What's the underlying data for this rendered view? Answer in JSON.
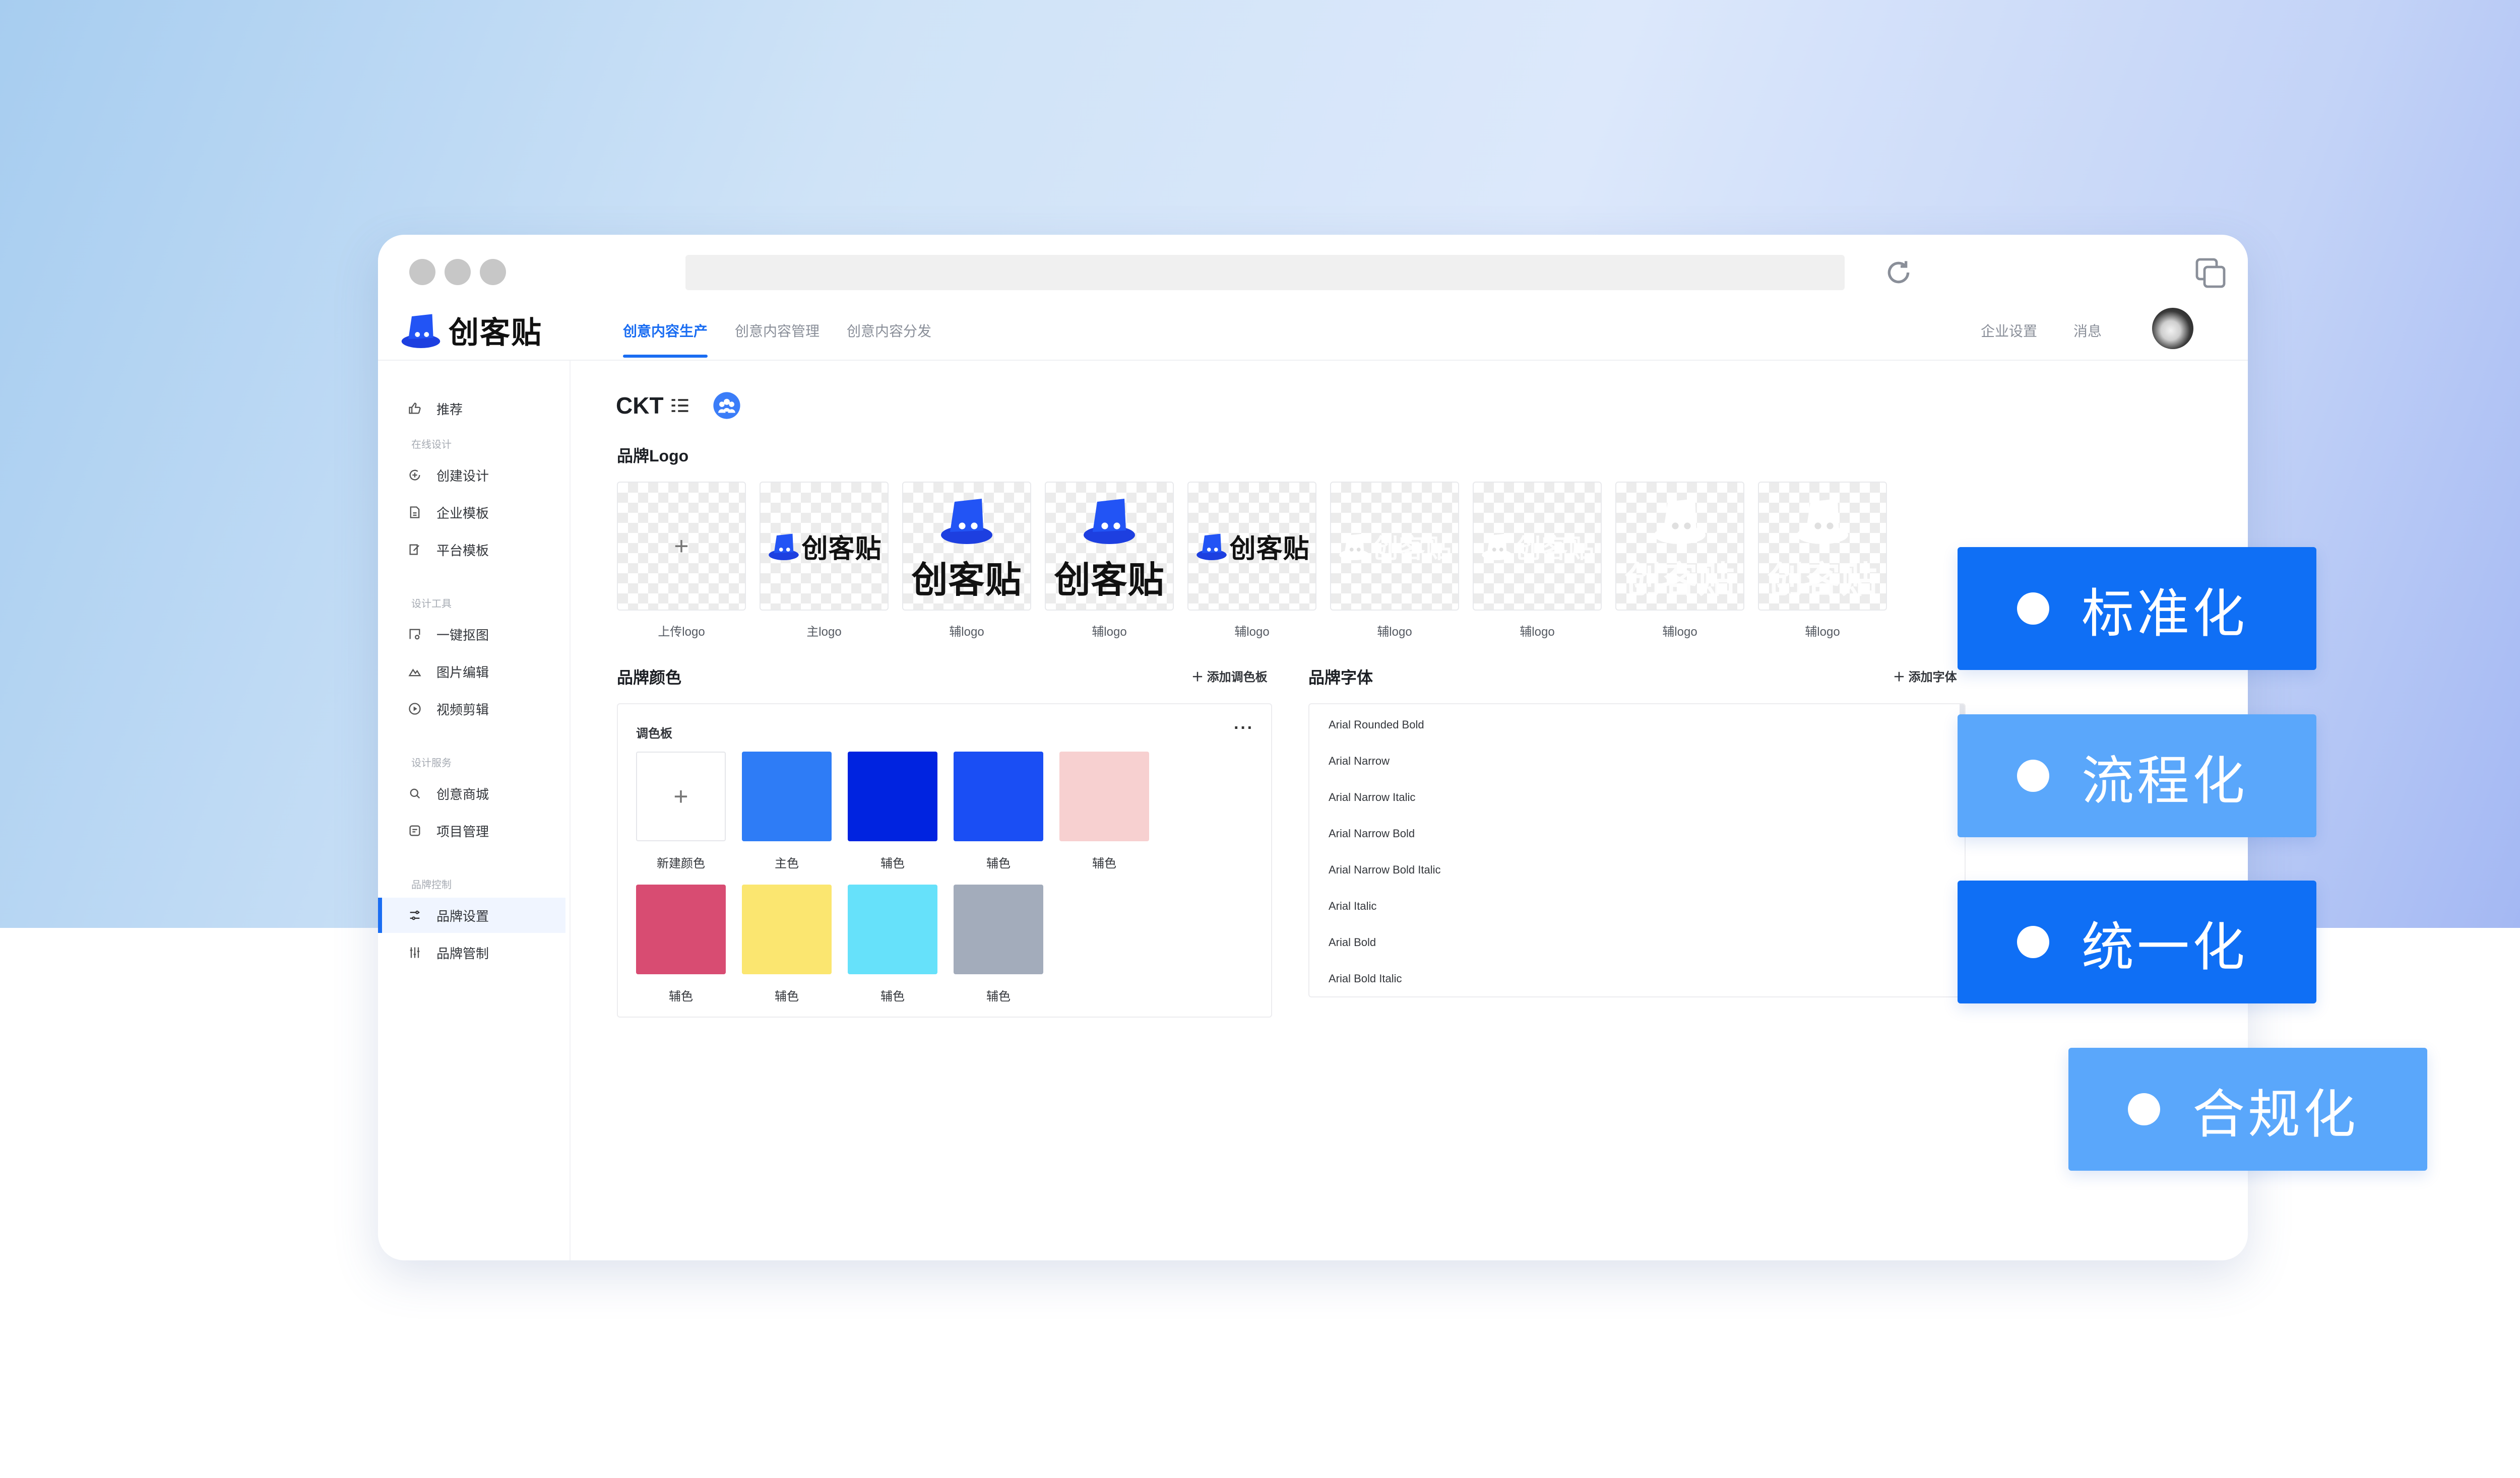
{
  "app": {
    "name": "创客贴",
    "workspace_title": "CKT"
  },
  "nav": {
    "tabs": [
      "创意内容生产",
      "创意内容管理",
      "创意内容分发"
    ],
    "right_links": [
      "企业设置",
      "消息"
    ]
  },
  "sidebar": {
    "top_item": "推荐",
    "groups": [
      {
        "title": "在线设计",
        "items": [
          "创建设计",
          "企业模板",
          "平台模板"
        ]
      },
      {
        "title": "设计工具",
        "items": [
          "一键抠图",
          "图片编辑",
          "视频剪辑"
        ]
      },
      {
        "title": "设计服务",
        "items": [
          "创意商城",
          "项目管理"
        ]
      },
      {
        "title": "品牌控制",
        "items": [
          "品牌设置",
          "品牌管制"
        ]
      }
    ]
  },
  "brand_logo": {
    "title": "品牌Logo",
    "cards": [
      {
        "caption": "上传logo",
        "kind": "upload"
      },
      {
        "caption": "主logo",
        "kind": "horizontal",
        "text": "创客贴"
      },
      {
        "caption": "辅logo",
        "kind": "stacked",
        "text": "创客贴"
      },
      {
        "caption": "辅logo",
        "kind": "stacked",
        "text": "创客贴"
      },
      {
        "caption": "辅logo",
        "kind": "horizontal",
        "text": "创客贴"
      },
      {
        "caption": "辅logo",
        "kind": "ghost-horizontal",
        "text": "创客贴"
      },
      {
        "caption": "辅logo",
        "kind": "ghost-horizontal",
        "text": "创客贴"
      },
      {
        "caption": "辅logo",
        "kind": "ghost-stacked",
        "text": "创客贴"
      },
      {
        "caption": "辅logo",
        "kind": "ghost-stacked",
        "text": "创客贴"
      }
    ]
  },
  "brand_color": {
    "title": "品牌颜色",
    "add_label": "添加调色板",
    "palette_title": "调色板",
    "menu_glyph": "···",
    "new_color_label": "新建颜色",
    "swatches": [
      {
        "label": "主色",
        "color": "#2e7cf6"
      },
      {
        "label": "辅色",
        "color": "#0023e0"
      },
      {
        "label": "辅色",
        "color": "#1a4ef4"
      },
      {
        "label": "辅色",
        "color": "#f7d0d0"
      },
      {
        "label": "辅色",
        "color": "#d84c72"
      },
      {
        "label": "辅色",
        "color": "#fbe670"
      },
      {
        "label": "辅色",
        "color": "#66e1fa"
      },
      {
        "label": "辅色",
        "color": "#a3acbb"
      }
    ]
  },
  "brand_font": {
    "title": "品牌字体",
    "add_label": "添加字体",
    "fonts": [
      "Arial Rounded Bold",
      "Arial Narrow",
      "Arial Narrow Italic",
      "Arial Narrow Bold",
      "Arial Narrow Bold Italic",
      "Arial Italic",
      "Arial Bold",
      "Arial Bold Italic"
    ]
  },
  "tags": [
    "标准化",
    "流程化",
    "统一化",
    "合规化"
  ],
  "colors": {
    "accent": "#1a6df2",
    "tag_dark": "#0f6ff5",
    "tag_light": "#5aa7fb"
  }
}
